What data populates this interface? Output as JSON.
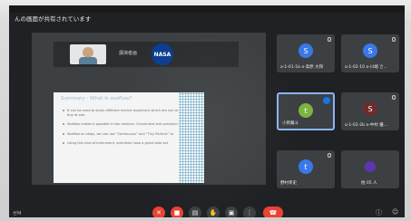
{
  "banner": {
    "text": "んの画面が共有されています"
  },
  "presentation": {
    "caption": "講演者画",
    "logo_text": "NASA",
    "slide_title": "Summary - What is seaflow?",
    "bullets": [
      "It can be used to study different marine organisms which are not so tiny at sea.",
      "Seaflow makes it possible in two reasons: Convenient and precision.",
      "Seaflow on ships, we can use “Continuous” and “Tiny Particle” to",
      "Using this kind of instrument, scientists have a great data set."
    ]
  },
  "participants": [
    {
      "name": "a-1-01-1b a-高原 大和",
      "initial": "S",
      "color": "#3b78e7"
    },
    {
      "name": "a-1-02-10 a-川端 さ...",
      "initial": "S",
      "color": "#3b78e7"
    },
    {
      "name": "小原翼斗",
      "initial": "t",
      "color": "#7cb342"
    },
    {
      "name": "a-1-02-2b a-中村 優...",
      "initial": "S",
      "color": "#6d2c2c"
    },
    {
      "name": "野村孝史",
      "initial": "t",
      "color": "#3b78e7"
    },
    {
      "name": "他 05 人",
      "initial": "",
      "color": "#5e35b1"
    }
  ],
  "toolbar": {
    "left_label": "ゼM",
    "mic_icon": "mic-off-icon",
    "cam_icon": "camera-off-icon",
    "captions_icon": "captions-icon",
    "hand_icon": "raise-hand-icon",
    "present_icon": "present-icon",
    "more_icon": "more-icon",
    "end_icon": "end-call-icon"
  }
}
